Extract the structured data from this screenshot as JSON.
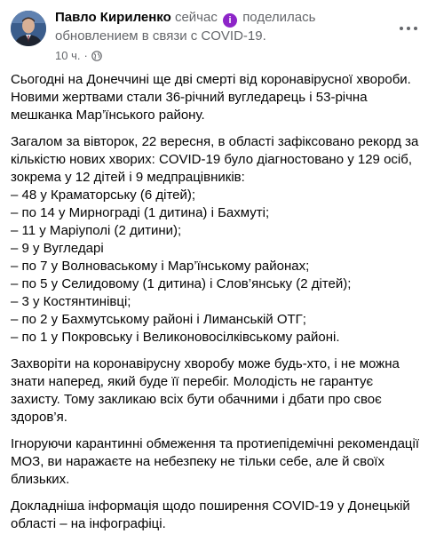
{
  "post": {
    "author": "Павло Кириленко",
    "time_label": "сейчас",
    "badge_letter": "i",
    "action_line1": "поделилась",
    "action_line2": "обновлением в связи с COVID-19.",
    "timestamp": "10 ч.",
    "icons": {
      "more": "more-horizontal-icon",
      "privacy": "globe-icon",
      "badge": "info-badge-icon"
    },
    "colors": {
      "badge": "#8d25c8",
      "muted": "#65676b",
      "text": "#050505"
    },
    "paragraphs": [
      "Сьогодні на Донеччині ще дві смерті від коронавірусної хвороби. Новими жертвами стали 36-річний вугледарець і 53-річна мешканка Мар’їнського району.",
      "Загалом за вівторок, 22 вересня, в області зафіксовано рекорд за кількістю нових хворих: COVID-19 було діагностовано у 129 осіб, зокрема у 12 дітей і 9 медпрацівників:",
      "Захворіти на коронавірусну хворобу може будь-хто, і не можна знати наперед, який буде її перебіг. Молодість не гарантує захисту. Тому закликаю всіх бути обачними і дбати про своє здоров’я.",
      "Ігноруючи карантинні обмеження та протиепідемічні рекомендації МОЗ, ви наражаєте на небезпеку не тільки себе, але й своїх близьких.",
      "Докладніша інформація щодо поширення COVID-19 у Донецькій області – на інфографіці."
    ],
    "list": [
      "– 48 у Краматорську (6 дітей);",
      "– по 14 у Мирнограді (1 дитина) і Бахмуті;",
      "– 11 у Маріуполі (2 дитини);",
      "– 9 у Вугледарі",
      "– по 7 у Волноваському і Мар’їнському районах;",
      "– по 5 у Селидовому (1 дитина) і Слов’янську (2 дітей);",
      "– 3 у Костянтинівці;",
      "– по 2 у Бахмутському районі і Лиманській ОТГ;",
      "– по 1 у Покровську і Великоновосілківському районі."
    ]
  }
}
